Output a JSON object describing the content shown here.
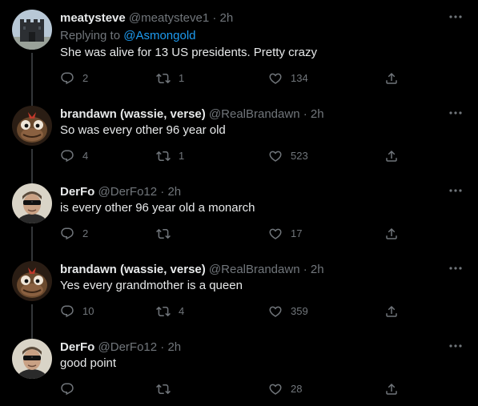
{
  "tweets": [
    {
      "name": "meatysteve",
      "handle": "@meatysteve1",
      "separator": "·",
      "time": "2h",
      "replying_prefix": "Replying to ",
      "replying_to": "@Asmongold",
      "text": "She was alive for 13 US presidents. Pretty crazy",
      "replies": "2",
      "retweets": "1",
      "likes": "134",
      "avatar_icon": "castle-avatar"
    },
    {
      "name": "brandawn (wassie, verse)",
      "handle": "@RealBrandawn",
      "separator": "·",
      "time": "2h",
      "text": "So was every other 96 year old",
      "replies": "4",
      "retweets": "1",
      "likes": "523",
      "avatar_icon": "wassie-avatar"
    },
    {
      "name": "DerFo",
      "handle": "@DerFo12",
      "separator": "·",
      "time": "2h",
      "text": "is every other 96 year old a monarch",
      "replies": "2",
      "retweets": "",
      "likes": "17",
      "avatar_icon": "sunglasses-person-avatar"
    },
    {
      "name": "brandawn (wassie, verse)",
      "handle": "@RealBrandawn",
      "separator": "·",
      "time": "2h",
      "text": "Yes every grandmother is a queen",
      "replies": "10",
      "retweets": "4",
      "likes": "359",
      "avatar_icon": "wassie-avatar"
    },
    {
      "name": "DerFo",
      "handle": "@DerFo12",
      "separator": "·",
      "time": "2h",
      "text": "good point",
      "replies": "",
      "retweets": "",
      "likes": "28",
      "avatar_icon": "sunglasses-person-avatar"
    }
  ],
  "colors": {
    "background": "#000000",
    "text": "#e7e9ea",
    "muted": "#71767b",
    "link": "#1d9bf0",
    "thread_line": "#333639"
  }
}
